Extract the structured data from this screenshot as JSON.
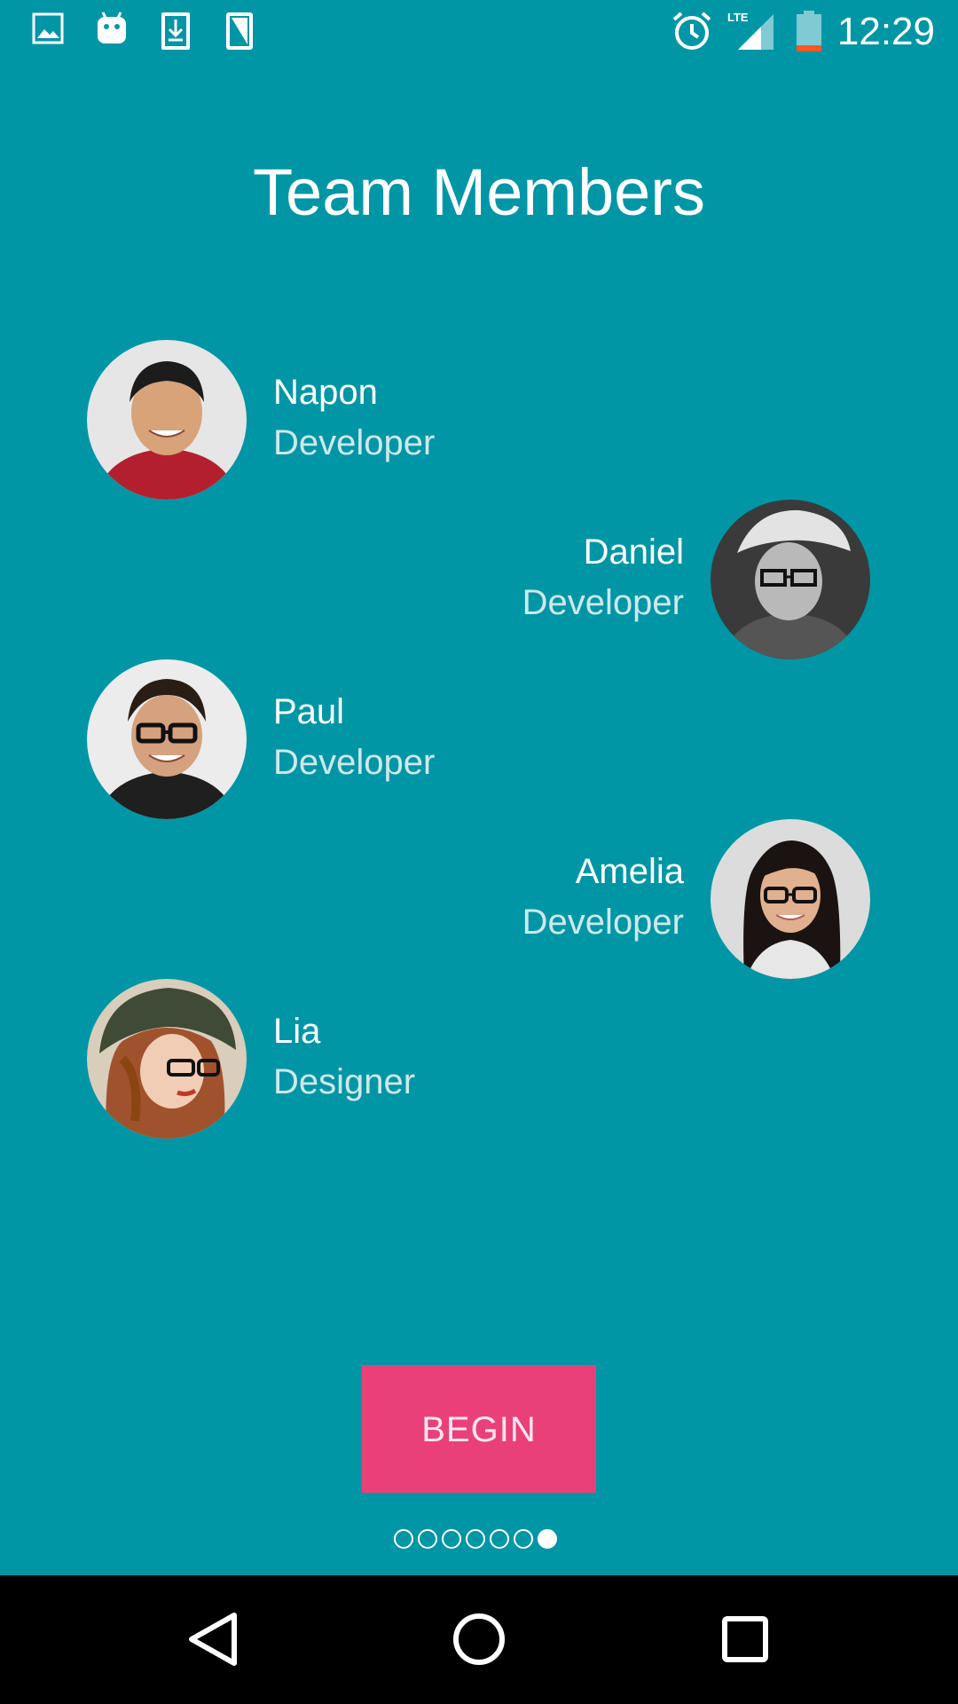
{
  "status_bar": {
    "time": "12:29",
    "network_label": "LTE",
    "notification_icons": [
      "image-icon",
      "android-icon",
      "download-icon",
      "sim-card-icon"
    ],
    "system_icons": [
      "alarm-icon",
      "signal-icon",
      "battery-icon"
    ]
  },
  "page": {
    "title": "Team Members"
  },
  "members": [
    {
      "name": "Napon",
      "role": "Developer"
    },
    {
      "name": "Daniel",
      "role": "Developer"
    },
    {
      "name": "Paul",
      "role": "Developer"
    },
    {
      "name": "Amelia",
      "role": "Developer"
    },
    {
      "name": "Lia",
      "role": "Designer"
    }
  ],
  "actions": {
    "begin_label": "BEGIN"
  },
  "pagination": {
    "total_pages": 7,
    "current_page": 7
  },
  "colors": {
    "background": "#0096a6",
    "accent": "#ea4079",
    "text_primary": "#ffffff",
    "text_secondary": "#cfe8eb"
  },
  "navigation_bar": {
    "buttons": [
      "back-icon",
      "home-icon",
      "recent-apps-icon"
    ]
  }
}
